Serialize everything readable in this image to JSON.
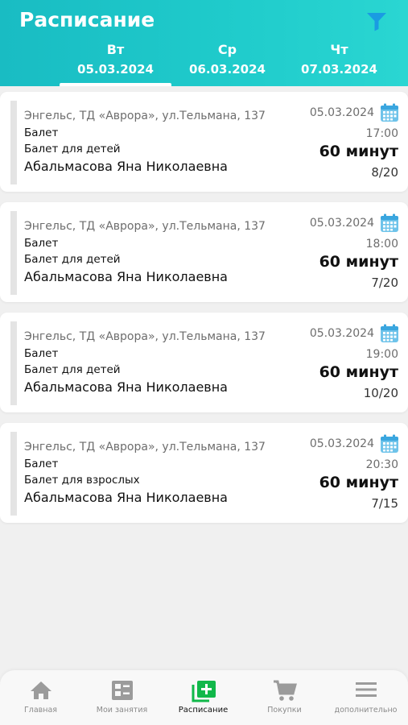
{
  "header": {
    "title": "Расписание",
    "filter_icon": "filter-icon"
  },
  "colors": {
    "accent": "#1fc8c8",
    "icon_blue": "#1a9be2",
    "active_nav": "#11b84a",
    "inactive_nav": "#9b9b9b"
  },
  "tabs": [
    {
      "day": "Вт",
      "date": "05.03.2024",
      "active": true
    },
    {
      "day": "Ср",
      "date": "06.03.2024",
      "active": false
    },
    {
      "day": "Чт",
      "date": "07.03.2024",
      "active": false
    }
  ],
  "lessons": [
    {
      "address": "Энгельс, ТД «Аврора», ул.Тельмана, 137",
      "category": "Балет",
      "class": "Балет для детей",
      "teacher": "Абальмасова Яна Николаевна",
      "date": "05.03.2024",
      "time": "17:00",
      "duration": "60 минут",
      "seats": "8/20"
    },
    {
      "address": "Энгельс, ТД «Аврора», ул.Тельмана, 137",
      "category": "Балет",
      "class": "Балет для детей",
      "teacher": "Абальмасова Яна Николаевна",
      "date": "05.03.2024",
      "time": "18:00",
      "duration": "60 минут",
      "seats": "7/20"
    },
    {
      "address": "Энгельс, ТД «Аврора», ул.Тельмана, 137",
      "category": "Балет",
      "class": "Балет для детей",
      "teacher": "Абальмасова Яна Николаевна",
      "date": "05.03.2024",
      "time": "19:00",
      "duration": "60 минут",
      "seats": "10/20"
    },
    {
      "address": "Энгельс, ТД «Аврора», ул.Тельмана, 137",
      "category": "Балет",
      "class": "Балет для взрослых",
      "teacher": "Абальмасова Яна Николаевна",
      "date": "05.03.2024",
      "time": "20:30",
      "duration": "60 минут",
      "seats": "7/15"
    }
  ],
  "nav": [
    {
      "label": "Главная",
      "icon": "home-icon",
      "active": false
    },
    {
      "label": "Мои занятия",
      "icon": "my-classes-icon",
      "active": false
    },
    {
      "label": "Расписание",
      "icon": "schedule-add-icon",
      "active": true
    },
    {
      "label": "Покупки",
      "icon": "cart-icon",
      "active": false
    },
    {
      "label": "дополнительно",
      "icon": "menu-icon",
      "active": false
    }
  ]
}
